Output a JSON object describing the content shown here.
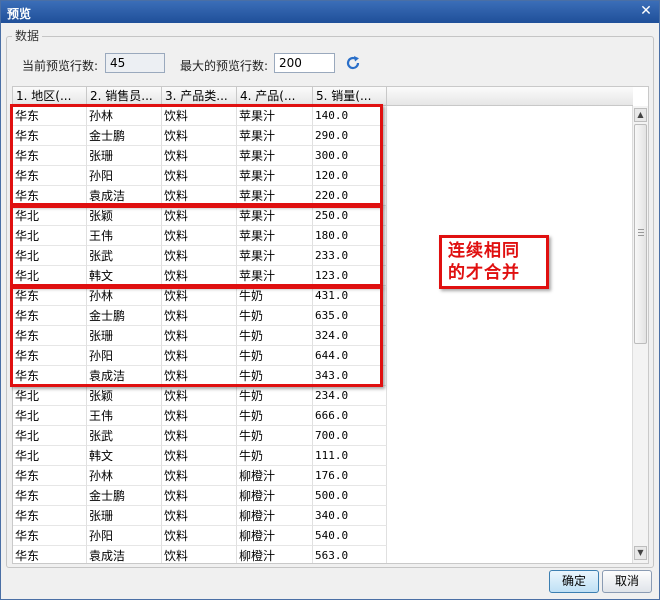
{
  "window": {
    "title": "预览",
    "close_glyph": "✕"
  },
  "group": {
    "label": "数据"
  },
  "preview": {
    "current_label": "当前预览行数:",
    "current_value": "45",
    "max_label": "最大的预览行数:",
    "max_value": "200",
    "refresh_icon": "refresh-icon"
  },
  "table": {
    "columns": [
      "1. 地区(...",
      "2. 销售员...",
      "3. 产品类...",
      "4. 产品(...",
      "5. 销量(..."
    ],
    "rows": [
      [
        "华东",
        "孙林",
        "饮料",
        "苹果汁",
        "140.0"
      ],
      [
        "华东",
        "金士鹏",
        "饮料",
        "苹果汁",
        "290.0"
      ],
      [
        "华东",
        "张珊",
        "饮料",
        "苹果汁",
        "300.0"
      ],
      [
        "华东",
        "孙阳",
        "饮料",
        "苹果汁",
        "120.0"
      ],
      [
        "华东",
        "袁成洁",
        "饮料",
        "苹果汁",
        "220.0"
      ],
      [
        "华北",
        "张颖",
        "饮料",
        "苹果汁",
        "250.0"
      ],
      [
        "华北",
        "王伟",
        "饮料",
        "苹果汁",
        "180.0"
      ],
      [
        "华北",
        "张武",
        "饮料",
        "苹果汁",
        "233.0"
      ],
      [
        "华北",
        "韩文",
        "饮料",
        "苹果汁",
        "123.0"
      ],
      [
        "华东",
        "孙林",
        "饮料",
        "牛奶",
        "431.0"
      ],
      [
        "华东",
        "金士鹏",
        "饮料",
        "牛奶",
        "635.0"
      ],
      [
        "华东",
        "张珊",
        "饮料",
        "牛奶",
        "324.0"
      ],
      [
        "华东",
        "孙阳",
        "饮料",
        "牛奶",
        "644.0"
      ],
      [
        "华东",
        "袁成洁",
        "饮料",
        "牛奶",
        "343.0"
      ],
      [
        "华北",
        "张颖",
        "饮料",
        "牛奶",
        "234.0"
      ],
      [
        "华北",
        "王伟",
        "饮料",
        "牛奶",
        "666.0"
      ],
      [
        "华北",
        "张武",
        "饮料",
        "牛奶",
        "700.0"
      ],
      [
        "华北",
        "韩文",
        "饮料",
        "牛奶",
        "111.0"
      ],
      [
        "华东",
        "孙林",
        "饮料",
        "柳橙汁",
        "176.0"
      ],
      [
        "华东",
        "金士鹏",
        "饮料",
        "柳橙汁",
        "500.0"
      ],
      [
        "华东",
        "张珊",
        "饮料",
        "柳橙汁",
        "340.0"
      ],
      [
        "华东",
        "孙阳",
        "饮料",
        "柳橙汁",
        "540.0"
      ],
      [
        "华东",
        "袁成洁",
        "饮料",
        "柳橙汁",
        "563.0"
      ]
    ]
  },
  "annotation": {
    "text": "连续相同\n的才合并",
    "color": "#e01010"
  },
  "buttons": {
    "ok": "确定",
    "cancel": "取消"
  }
}
